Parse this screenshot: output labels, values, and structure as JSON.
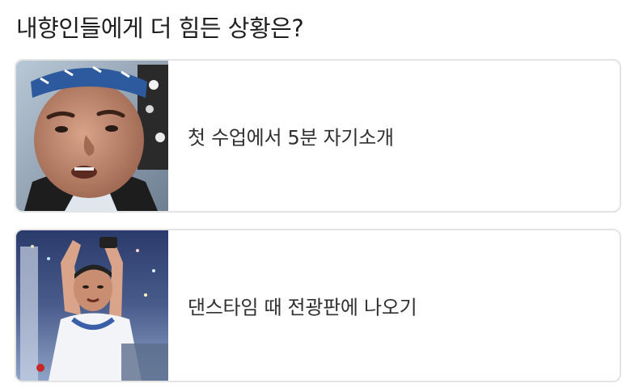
{
  "question": {
    "title": "내향인들에게 더 힘든 상황은?"
  },
  "options": [
    {
      "label": "첫 수업에서 5분 자기소개",
      "image": "man-with-bandana-photo"
    },
    {
      "label": "댄스타임 때 전광판에 나오기",
      "image": "man-dancing-in-stadium-photo"
    }
  ],
  "colors": {
    "card_border": "#e4e4e4",
    "text": "#303030",
    "title": "#1e1e1e"
  }
}
